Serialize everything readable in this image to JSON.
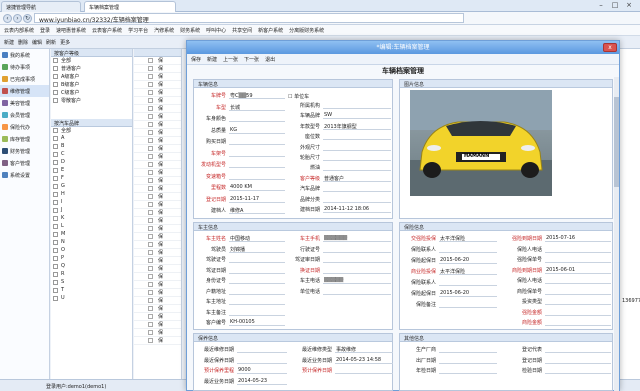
{
  "browser": {
    "tab1": "速捷管理导航",
    "tab2": "车辆档案管理",
    "url": "www.iyunbiao.cn/32332/车辆档案管理",
    "bookmarks": [
      "云表内部系统",
      "登录",
      "速吧惠普系统",
      "云表客户系统",
      "学习平台",
      "汽修系统",
      "财务系统",
      "呼叫中心",
      "共享空间",
      "新客户系统",
      "分离版财务系统"
    ]
  },
  "app_toolbar": [
    "新建",
    "删除",
    "编辑",
    "刷新",
    "更多"
  ],
  "sidebar": [
    "我的系统",
    "待办事项",
    "已完成事项",
    "维修管理",
    "美容管理",
    "会员管理",
    "保险代办",
    "库存管理",
    "财务管理",
    "客户管理",
    "系统设置"
  ],
  "tree_top": {
    "title": "按客户等级",
    "items": [
      "全部",
      "普通客户",
      "A级客户",
      "B级客户",
      "C级客户",
      "零散客户"
    ]
  },
  "tree_bottom": {
    "title": "按汽车品牌",
    "items": [
      "全部",
      "A",
      "B",
      "C",
      "D",
      "E",
      "F",
      "G",
      "H",
      "I",
      "J",
      "K",
      "L",
      "M",
      "N",
      "O",
      "P",
      "Q",
      "R",
      "S",
      "T",
      "U"
    ]
  },
  "grid_rows": [
    "保",
    "保",
    "保",
    "保",
    "保",
    "保",
    "保",
    "保",
    "保",
    "保",
    "保",
    "保",
    "保",
    "保",
    "保",
    "保",
    "保",
    "保",
    "保",
    "保",
    "保",
    "保",
    "保",
    "保",
    "保",
    "保",
    "保",
    "保",
    "保",
    "保",
    "保",
    "保",
    "保",
    "保",
    "保",
    "保"
  ],
  "right_col": "136977",
  "status": "登录用户:demo1(demo1)",
  "tray": "S 中 ·, 简 ☆",
  "dialog": {
    "title": "*编辑:车辆档案管理",
    "close": "x",
    "toolbar": [
      "保存",
      "新建",
      "上一张",
      "下一张",
      "退出"
    ],
    "header": "车辆档案管理",
    "car_section": "车辆信息",
    "car_fields": [
      {
        "label": "车牌号",
        "value": "粤C▒▒59",
        "red": true
      },
      {
        "label": "车型",
        "value": "长城",
        "red": true
      },
      {
        "label": "车身颜色",
        "value": ""
      },
      {
        "label": "总质量",
        "value": "KG"
      },
      {
        "label": "购买日期",
        "value": ""
      },
      {
        "label": "车架号",
        "value": "",
        "red": true
      },
      {
        "label": "发动机型号",
        "value": "",
        "red": true
      },
      {
        "label": "变速箱号",
        "value": "",
        "red": true
      },
      {
        "label": "里程数",
        "value": "4000 KM",
        "red": true
      },
      {
        "label": "登记日期",
        "value": "2015-11-17",
        "red": true
      },
      {
        "label": "建档人",
        "value": "维修A"
      }
    ],
    "unit_car": "单位车",
    "car_fields2": [
      {
        "label": "所属机构",
        "value": ""
      },
      {
        "label": "车辆品牌",
        "value": "SW"
      },
      {
        "label": "年款型号",
        "value": "2013年旗舰型"
      },
      {
        "label": "座位数",
        "value": ""
      },
      {
        "label": "外观尺寸",
        "value": ""
      },
      {
        "label": "轮胎尺寸",
        "value": ""
      },
      {
        "label": "燃油",
        "value": ""
      },
      {
        "label": "客户等级",
        "value": "普通客户",
        "red": true
      },
      {
        "label": "汽车品牌",
        "value": ""
      },
      {
        "label": "品牌分类",
        "value": ""
      },
      {
        "label": "建档日期",
        "value": "2014-11-12 18:06"
      }
    ],
    "pic_section": "图片信息",
    "car_brand_badge": "HAMANN",
    "owner_section": "车主信息",
    "owner_fields": [
      {
        "label": "车主姓名",
        "value": "中国移动",
        "red": true
      },
      {
        "label": "驾驶员",
        "value": "刘锦播"
      },
      {
        "label": "驾驶证号",
        "value": ""
      },
      {
        "label": "驾证日期",
        "value": ""
      },
      {
        "label": "身份证号",
        "value": ""
      },
      {
        "label": "户籍地址",
        "value": ""
      },
      {
        "label": "车主地址",
        "value": ""
      },
      {
        "label": "车主备注",
        "value": ""
      },
      {
        "label": "客户编号",
        "value": "KH-00105"
      }
    ],
    "owner_fields2": [
      {
        "label": "车主手机",
        "value": "▒▒▒▒▒▒",
        "red": true
      },
      {
        "label": "行驶证号",
        "value": ""
      },
      {
        "label": "驾证审日期",
        "value": ""
      },
      {
        "label": "换证日期",
        "value": "",
        "red": true
      },
      {
        "label": "车主电话",
        "value": "▒▒▒▒▒"
      },
      {
        "label": "单位电话",
        "value": ""
      }
    ],
    "ins_section": "保险信息",
    "ins_fields": [
      {
        "label": "交强险投保",
        "value": "太平洋保险",
        "red": true
      },
      {
        "label": "保险联系人",
        "value": ""
      },
      {
        "label": "保险起保日",
        "value": "2015-06-20"
      },
      {
        "label": "商业险投保",
        "value": "太平洋保险",
        "red": true
      },
      {
        "label": "保险联系人",
        "value": ""
      },
      {
        "label": "保险起保日",
        "value": "2015-06-20"
      },
      {
        "label": "保险备注",
        "value": ""
      }
    ],
    "ins_fields2": [
      {
        "label": "强险到期日期",
        "value": "2015-07-16",
        "red": true
      },
      {
        "label": "保险人电话",
        "value": ""
      },
      {
        "label": "强险保单号",
        "value": ""
      },
      {
        "label": "商险到期日期",
        "value": "2015-06-01",
        "red": true
      },
      {
        "label": "保险人电话",
        "value": ""
      },
      {
        "label": "商险保单号",
        "value": ""
      },
      {
        "label": "投资类型",
        "value": ""
      },
      {
        "label": "强险金额",
        "value": "",
        "red": true
      },
      {
        "label": "商险金额",
        "value": "",
        "red": true
      }
    ],
    "maint_section": "保养信息",
    "maint_fields": [
      {
        "label": "最近维修日期",
        "value": ""
      },
      {
        "label": "最近保养日期",
        "value": ""
      },
      {
        "label": "预计保养里程",
        "value": "9000",
        "red": true
      },
      {
        "label": "最近业务日期",
        "value": "2014-05-23"
      }
    ],
    "maint_fields2": [
      {
        "label": "最近维修类型",
        "value": "事故维修"
      },
      {
        "label": "最近业务日期",
        "value": "2014-05-23 14:58"
      },
      {
        "label": "预计保养日期",
        "value": "",
        "red": true
      }
    ],
    "other_section": "其他信息",
    "other_fields": [
      {
        "label": "生产厂商",
        "value": ""
      },
      {
        "label": "出厂日期",
        "value": ""
      },
      {
        "label": "年检日期",
        "value": ""
      }
    ],
    "other_fields2": [
      {
        "label": "登记代表",
        "value": ""
      },
      {
        "label": "登记日期",
        "value": ""
      },
      {
        "label": "检验日期",
        "value": ""
      }
    ]
  },
  "colors": {
    "accent": "#5b98e0",
    "label_red": "#c62828",
    "car_yellow": "#f2d32a"
  }
}
